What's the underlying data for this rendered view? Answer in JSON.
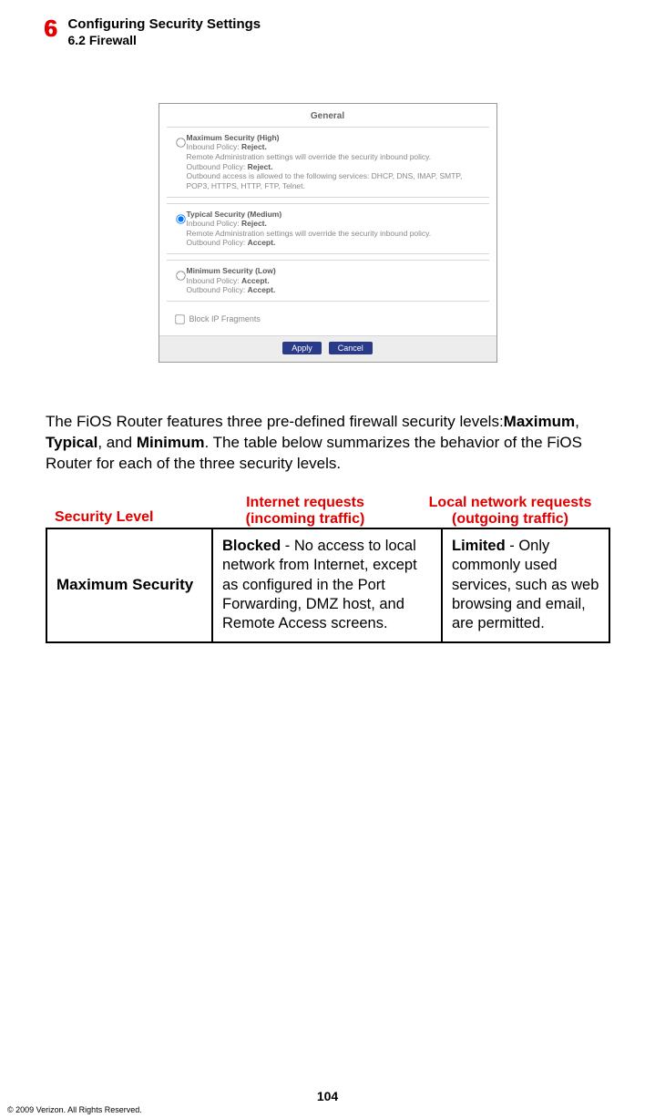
{
  "header": {
    "chapter_number": "6",
    "chapter_title": "Configuring Security Settings",
    "section_title": "6.2  Firewall"
  },
  "screenshot": {
    "panel_title": "General",
    "options": [
      {
        "selected": false,
        "title": "Maximum Security (High)",
        "lines": [
          {
            "label": "Inbound Policy:",
            "value": "Reject."
          },
          {
            "plain": "Remote Administration settings will override the security inbound policy."
          },
          {
            "label": "Outbound Policy:",
            "value": "Reject."
          },
          {
            "plain": "Outbound access is allowed to the following services: DHCP, DNS, IMAP, SMTP, POP3, HTTPS, HTTP, FTP, Telnet."
          }
        ]
      },
      {
        "selected": true,
        "title": "Typical Security (Medium)",
        "lines": [
          {
            "label": "Inbound Policy:",
            "value": "Reject."
          },
          {
            "plain": "Remote Administration settings will override the security inbound policy."
          },
          {
            "label": "Outbound Policy:",
            "value": "Accept."
          }
        ]
      },
      {
        "selected": false,
        "title": "Minimum Security (Low)",
        "lines": [
          {
            "label": "Inbound Policy:",
            "value": "Accept."
          },
          {
            "label": "Outbound Policy:",
            "value": "Accept."
          }
        ]
      }
    ],
    "block_ip_label": "Block IP Fragments",
    "buttons": {
      "apply": "Apply",
      "cancel": "Cancel"
    }
  },
  "body_paragraph": {
    "pre": "The FiOS Router features three pre-defined firewall security levels:",
    "b1": "Maximum",
    "mid1": ", ",
    "b2": "Typical",
    "mid2": ", and ",
    "b3": "Minimum",
    "post": ". The table below summarizes the behavior of the FiOS Router for each of the three security levels."
  },
  "table": {
    "headers": {
      "c1": "Security Level",
      "c2_l1": "Internet requests",
      "c2_l2": "(incoming traffic)",
      "c3_l1": "Local network requests",
      "c3_l2": "(outgoing traffic)"
    },
    "row": {
      "c1": "Maximum Security",
      "c2_bold": "Blocked",
      "c2_rest": " - No access to local network from Internet, except as configured in the Port Forwarding, DMZ host, and Remote Access screens.",
      "c3_bold": "Limited",
      "c3_rest": " - Only commonly used services, such as web browsing and email, are permitted."
    }
  },
  "footer": {
    "page_number": "104",
    "copyright": "© 2009 Verizon. All Rights Reserved."
  }
}
